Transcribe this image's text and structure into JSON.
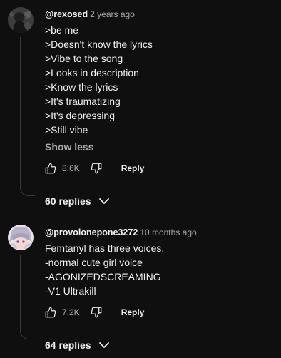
{
  "comments": [
    {
      "author": "@rexosed",
      "time": "2 years ago",
      "lines": [
        ">be me",
        ">Doesn't know the lyrics",
        ">Vibe to the song",
        ">Looks in description",
        ">Know the lyrics",
        ">It's traumatizing",
        ">It's depressing",
        ">Still vibe"
      ],
      "show_less": "Show less",
      "likes": "8.6K",
      "reply_label": "Reply",
      "replies_label": "60 replies"
    },
    {
      "author": "@provolonepone3272",
      "time": "10 months ago",
      "lines": [
        "Femtanyl has three voices.",
        "-normal cute girl voice",
        "-AGONIZEDSCREAMING",
        "-V1 Ultrakill"
      ],
      "likes": "7.2K",
      "reply_label": "Reply",
      "replies_label": "64 replies"
    }
  ],
  "icons": {
    "like": "thumbs-up-icon",
    "dislike": "thumbs-down-icon",
    "expand": "chevron-down-icon"
  },
  "colors": {
    "background": "#0f0f0f",
    "text_primary": "#f1f1f1",
    "text_secondary": "#aaaaaa"
  }
}
